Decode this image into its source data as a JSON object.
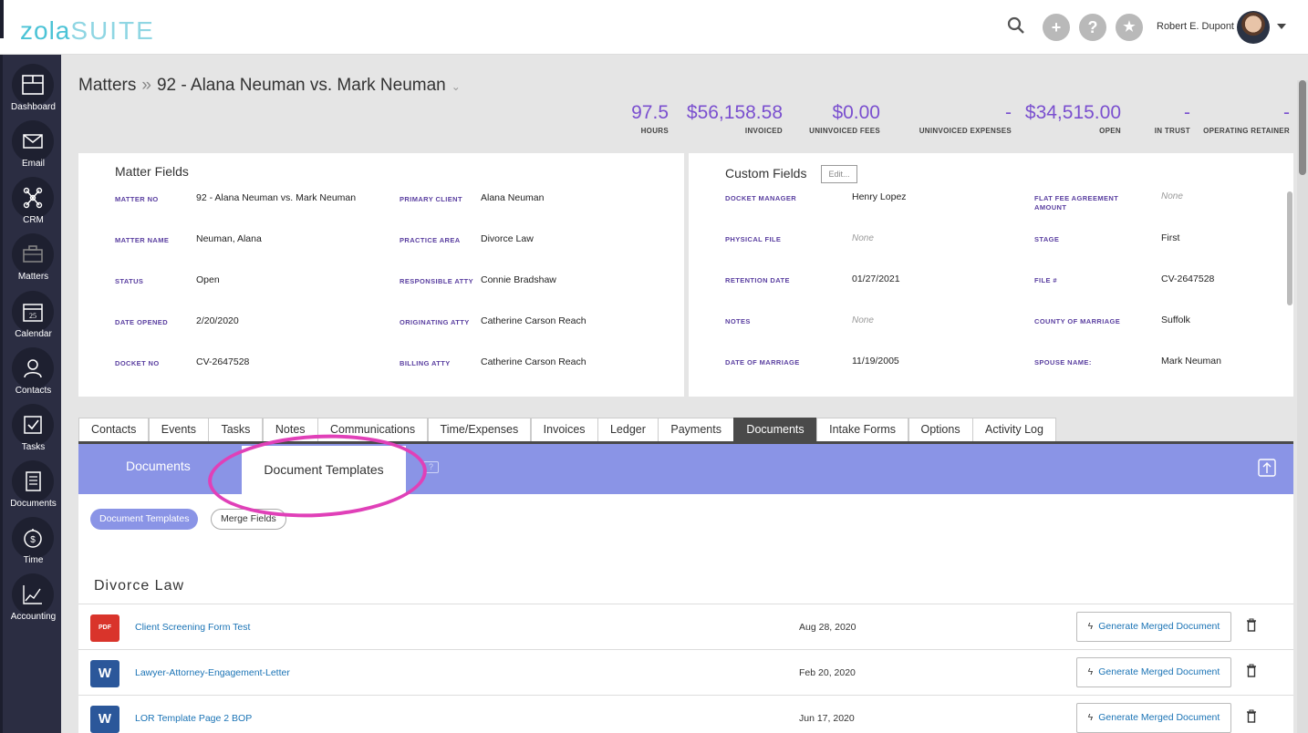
{
  "app": {
    "logo_part1": "zola",
    "logo_part2": "SUITE"
  },
  "user": {
    "name": "Robert E. Dupont"
  },
  "sidebar": {
    "items": [
      {
        "label": "Dashboard"
      },
      {
        "label": "Email"
      },
      {
        "label": "CRM"
      },
      {
        "label": "Matters"
      },
      {
        "label": "Calendar"
      },
      {
        "label": "Contacts"
      },
      {
        "label": "Tasks"
      },
      {
        "label": "Documents"
      },
      {
        "label": "Time"
      },
      {
        "label": "Accounting"
      }
    ],
    "calendar_day": "25"
  },
  "breadcrumb": {
    "root": "Matters",
    "separator": "»",
    "current": "92 - Alana Neuman vs. Mark Neuman"
  },
  "stats": [
    {
      "value": "97.5",
      "label": "HOURS"
    },
    {
      "value": "$56,158.58",
      "label": "INVOICED"
    },
    {
      "value": "$0.00",
      "label": "UNINVOICED FEES"
    },
    {
      "value": "-",
      "label": "UNINVOICED EXPENSES"
    },
    {
      "value": "$34,515.00",
      "label": "OPEN"
    },
    {
      "value": "-",
      "label": "IN TRUST"
    },
    {
      "value": "-",
      "label": "OPERATING RETAINER"
    }
  ],
  "matter_fields": {
    "title": "Matter Fields",
    "left": [
      {
        "label": "MATTER NO",
        "value": "92 - Alana Neuman vs. Mark Neuman"
      },
      {
        "label": "MATTER NAME",
        "value": "Neuman, Alana"
      },
      {
        "label": "STATUS",
        "value": "Open"
      },
      {
        "label": "DATE OPENED",
        "value": "2/20/2020"
      },
      {
        "label": "DOCKET NO",
        "value": "CV-2647528"
      }
    ],
    "right": [
      {
        "label": "PRIMARY CLIENT",
        "value": "Alana Neuman"
      },
      {
        "label": "PRACTICE AREA",
        "value": "Divorce Law"
      },
      {
        "label": "RESPONSIBLE ATTY",
        "value": "Connie Bradshaw"
      },
      {
        "label": "ORIGINATING ATTY",
        "value": "Catherine Carson Reach"
      },
      {
        "label": "BILLING ATTY",
        "value": "Catherine Carson Reach"
      }
    ]
  },
  "custom_fields": {
    "title": "Custom Fields",
    "edit_label": "Edit...",
    "left": [
      {
        "label": "DOCKET MANAGER",
        "value": "Henry Lopez"
      },
      {
        "label": "PHYSICAL FILE",
        "value": "None"
      },
      {
        "label": "RETENTION DATE",
        "value": "01/27/2021"
      },
      {
        "label": "NOTES",
        "value": "None"
      },
      {
        "label": "DATE OF MARRIAGE",
        "value": "11/19/2005"
      }
    ],
    "right": [
      {
        "label": "FLAT FEE AGREEMENT AMOUNT",
        "value": "None"
      },
      {
        "label": "STAGE",
        "value": "First"
      },
      {
        "label": "FILE #",
        "value": "CV-2647528"
      },
      {
        "label": "COUNTY OF MARRIAGE",
        "value": "Suffolk"
      },
      {
        "label": "SPOUSE NAME:",
        "value": "Mark Neuman"
      }
    ]
  },
  "tabs": [
    "Contacts",
    "Events",
    "Tasks",
    "Notes",
    "Communications",
    "Time/Expenses",
    "Invoices",
    "Ledger",
    "Payments",
    "Documents",
    "Intake Forms",
    "Options",
    "Activity Log"
  ],
  "active_tab": "Documents",
  "doc_bar": {
    "documents_tab": "Documents",
    "templates_tab": "Document Templates",
    "help": "?"
  },
  "pills": {
    "templates": "Document Templates",
    "merge": "Merge Fields"
  },
  "group": {
    "title": "Divorce Law"
  },
  "rows": [
    {
      "type": "pdf",
      "type_label": "PDF",
      "name": "Client Screening Form Test",
      "date": "Aug 28, 2020",
      "button": "Generate Merged Document"
    },
    {
      "type": "doc",
      "type_label": "W",
      "name": "Lawyer-Attorney-Engagement-Letter",
      "date": "Feb 20, 2020",
      "button": "Generate Merged Document"
    },
    {
      "type": "doc",
      "type_label": "W",
      "name": "LOR Template Page 2 BOP",
      "date": "Jun 17, 2020",
      "button": "Generate Merged Document"
    }
  ],
  "colors": {
    "accent_purple": "#7a4fcf",
    "doc_bar": "#8a94e6",
    "sidebar": "#2b2d42",
    "highlight": "#e040b8",
    "link": "#1a73b5"
  }
}
